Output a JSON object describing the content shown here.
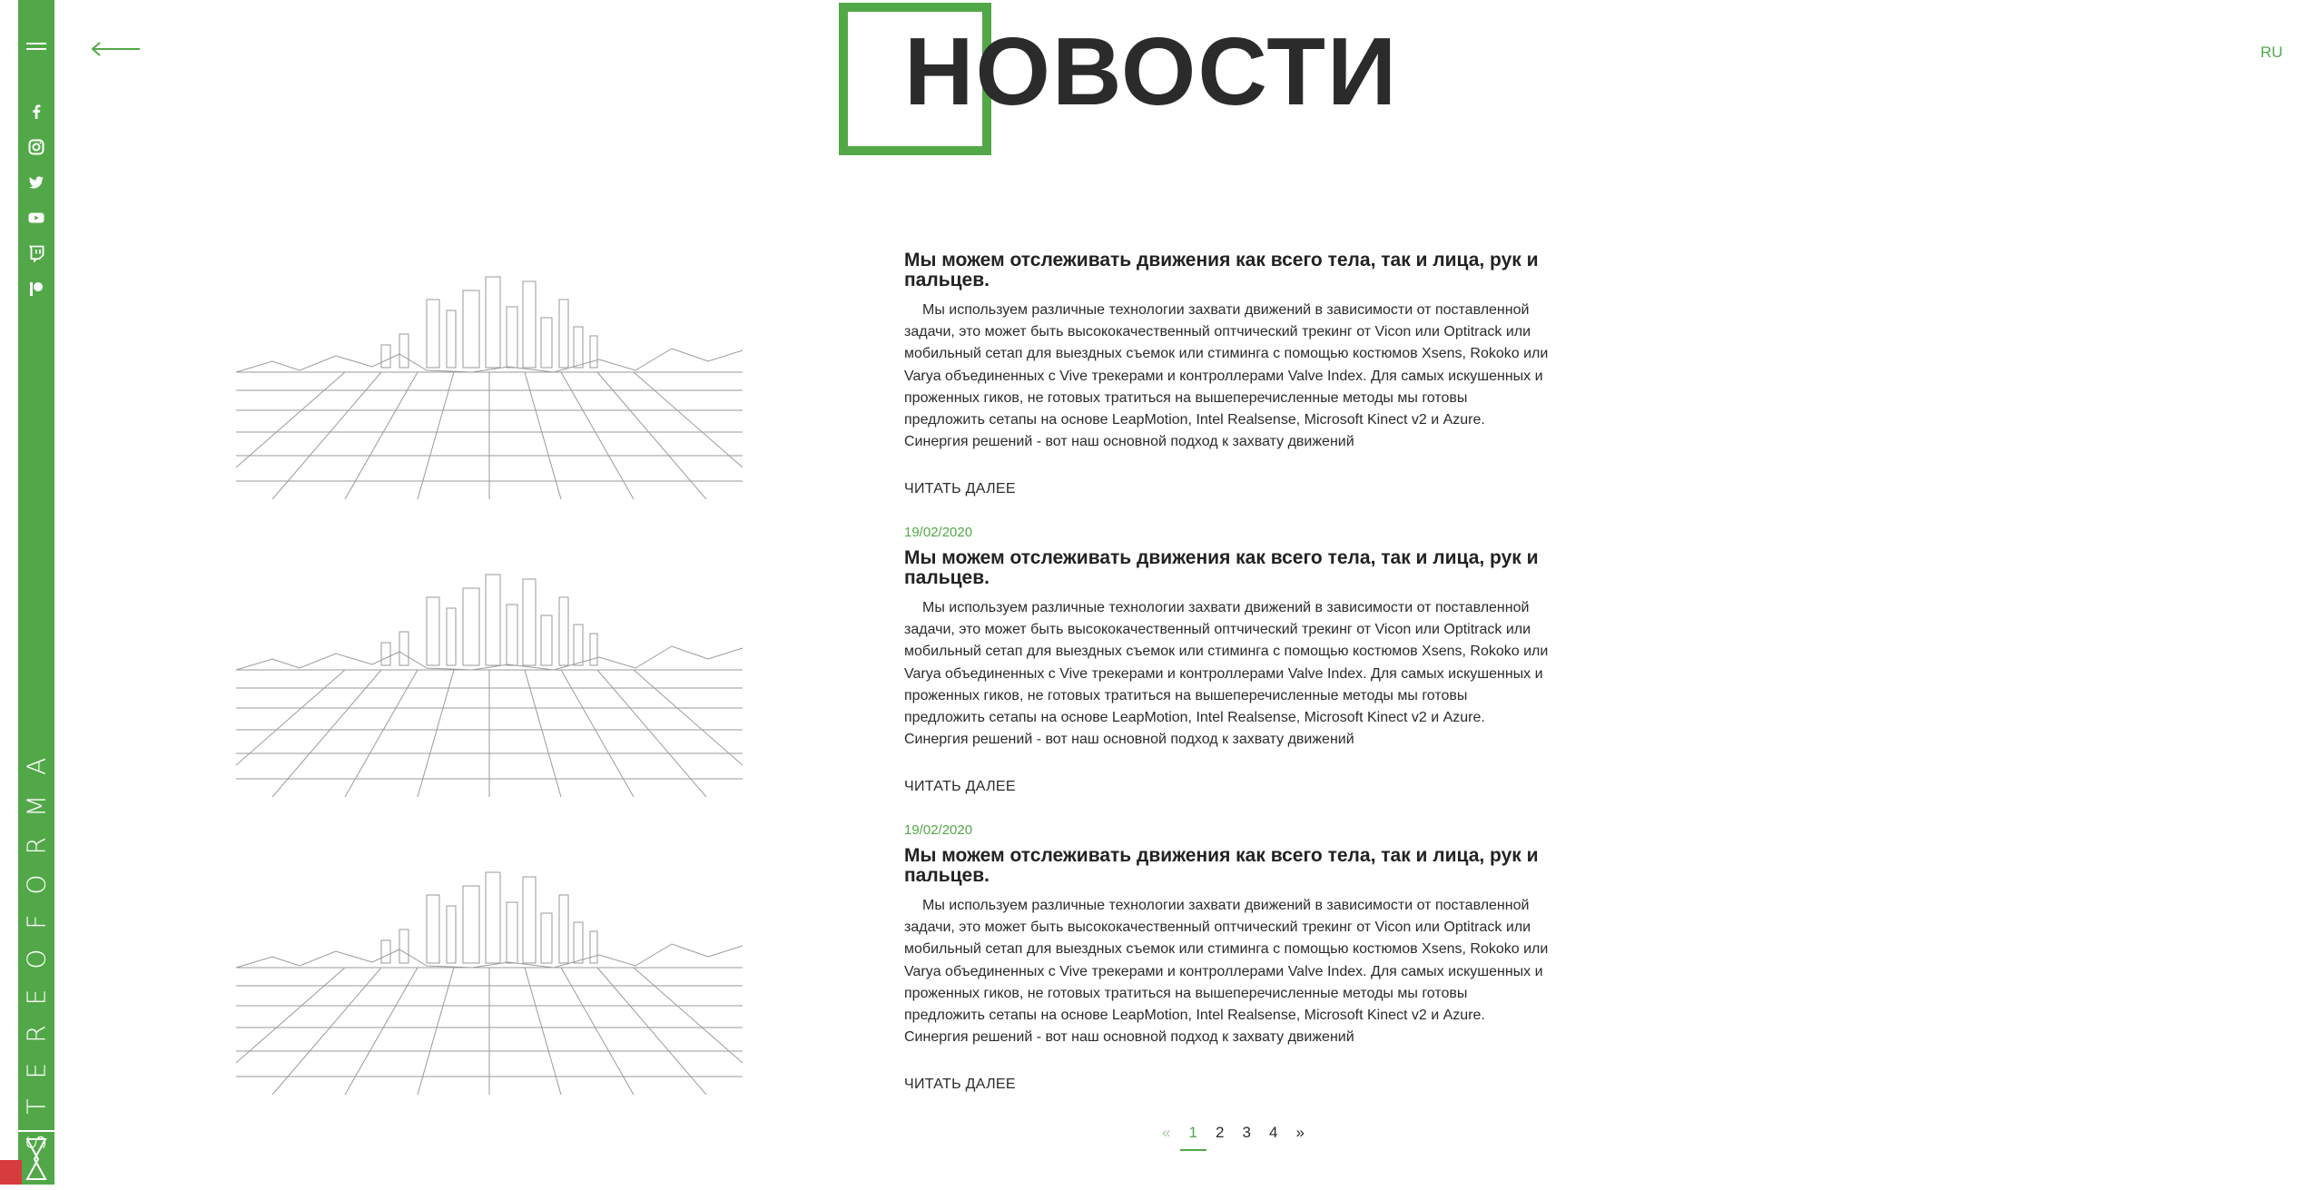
{
  "header": {
    "title": "НОВОСТИ",
    "back_icon": "arrow-left-icon",
    "lang": "RU"
  },
  "sidebar": {
    "menu_icon": "hamburger-icon",
    "brand": "STEREOFORMA",
    "social": [
      "facebook-icon",
      "instagram-icon",
      "twitter-icon",
      "youtube-icon",
      "twitch-icon",
      "patreon-icon"
    ],
    "logo_icon": "stereoforma-logo-icon"
  },
  "news": {
    "items": [
      {
        "date": "",
        "title": "Мы можем отслеживать движения как всего тела, так и лица, рук и пальцев.",
        "body": "Мы используем различные технологии захвати движений в зависимости от поставленной задачи, это может быть высококачественный оптчический трекинг от Vicon или Optitrack или мобильный сетап для выездных съемок или стиминга с помощью костюмов Xsens, Rokoko или Varya объединенных с Vive трекерами и контроллерами Valve Index. Для самых искушенных и проженных гиков, не готовых тратиться на вышеперечисленные методы мы готовы предложить сетапы на основе LeapMotion, Intel Realsense, Microsoft Kinect v2 и Azure. Синергия решений - вот наш основной подход к захвату движений",
        "more": "ЧИТАТЬ ДАЛЕЕ"
      },
      {
        "date": "19/02/2020",
        "title": "Мы можем отслеживать движения как всего тела, так и лица, рук и пальцев.",
        "body": "Мы используем различные технологии захвати движений в зависимости от поставленной задачи, это может быть высококачественный оптчический трекинг от Vicon или Optitrack или мобильный сетап для выездных съемок или стиминга с помощью костюмов Xsens, Rokoko или Varya объединенных с Vive трекерами и контроллерами Valve Index. Для самых искушенных и проженных гиков, не готовых тратиться на вышеперечисленные методы мы готовы предложить сетапы на основе LeapMotion, Intel Realsense, Microsoft Kinect v2 и Azure. Синергия решений - вот наш основной подход к захвату движений",
        "more": "ЧИТАТЬ ДАЛЕЕ"
      },
      {
        "date": "19/02/2020",
        "title": "Мы можем отслеживать движения как всего тела, так и лица, рук и пальцев.",
        "body": "Мы используем различные технологии захвати движений в зависимости от поставленной задачи, это может быть высококачественный оптчический трекинг от Vicon или Optitrack или мобильный сетап для выездных съемок или стиминга с помощью костюмов Xsens, Rokoko или Varya объединенных с Vive трекерами и контроллерами Valve Index. Для самых искушенных и проженных гиков, не готовых тратиться на вышеперечисленные методы мы готовы предложить сетапы на основе LeapMotion, Intel Realsense, Microsoft Kinect v2 и Azure. Синергия решений - вот наш основной подход к захвату движений",
        "more": "ЧИТАТЬ ДАЛЕЕ"
      }
    ]
  },
  "pagination": {
    "prev": "«",
    "pages": [
      "1",
      "2",
      "3",
      "4"
    ],
    "current": "1",
    "next": "»"
  },
  "colors": {
    "accent": "#52a848",
    "text": "#2b2b2b",
    "background": "#ffffff"
  }
}
